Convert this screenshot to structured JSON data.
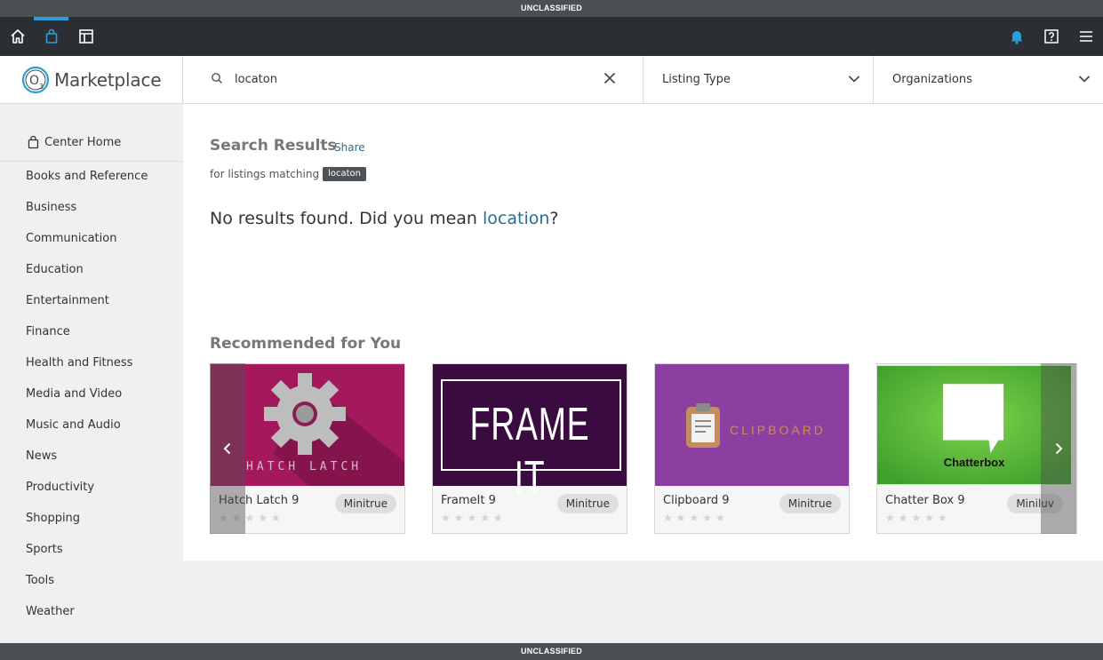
{
  "classification": {
    "top": "UNCLASSIFIED",
    "bottom": "UNCLASSIFIED"
  },
  "header": {
    "logo_text": "Marketplace",
    "search": {
      "value": "locaton"
    },
    "listing_type_label": "Listing Type",
    "organizations_label": "Organizations"
  },
  "sidebar": {
    "home_label": "Center Home",
    "categories": [
      "Books and Reference",
      "Business",
      "Communication",
      "Education",
      "Entertainment",
      "Finance",
      "Health and Fitness",
      "Media and Video",
      "Music and Audio",
      "News",
      "Productivity",
      "Shopping",
      "Sports",
      "Tools",
      "Weather"
    ]
  },
  "results": {
    "title": "Search Results",
    "share_label": "Share",
    "matching_prefix": "for listings matching",
    "query_tag": "locaton",
    "no_results_prefix": "No results found. Did you mean ",
    "suggestion": "location",
    "no_results_suffix": "?"
  },
  "recommended": {
    "title": "Recommended for You",
    "cards": [
      {
        "name": "Hatch Latch 9",
        "org": "Minitrue",
        "image_text": "HATCH LATCH",
        "rating": 0
      },
      {
        "name": "FrameIt 9",
        "org": "Minitrue",
        "image_text": "FRAME IT",
        "rating": 0
      },
      {
        "name": "Clipboard 9",
        "org": "Minitrue",
        "image_text": "CLIPBOARD",
        "rating": 0
      },
      {
        "name": "Chatter Box 9",
        "org": "Miniluv",
        "image_text": "Chatterbox",
        "rating": 0
      }
    ]
  },
  "colors": {
    "accent": "#2c9fd8",
    "link": "#2a6d8e",
    "nav_bg": "#2b2f33",
    "banner_bg": "#4a4f53"
  }
}
